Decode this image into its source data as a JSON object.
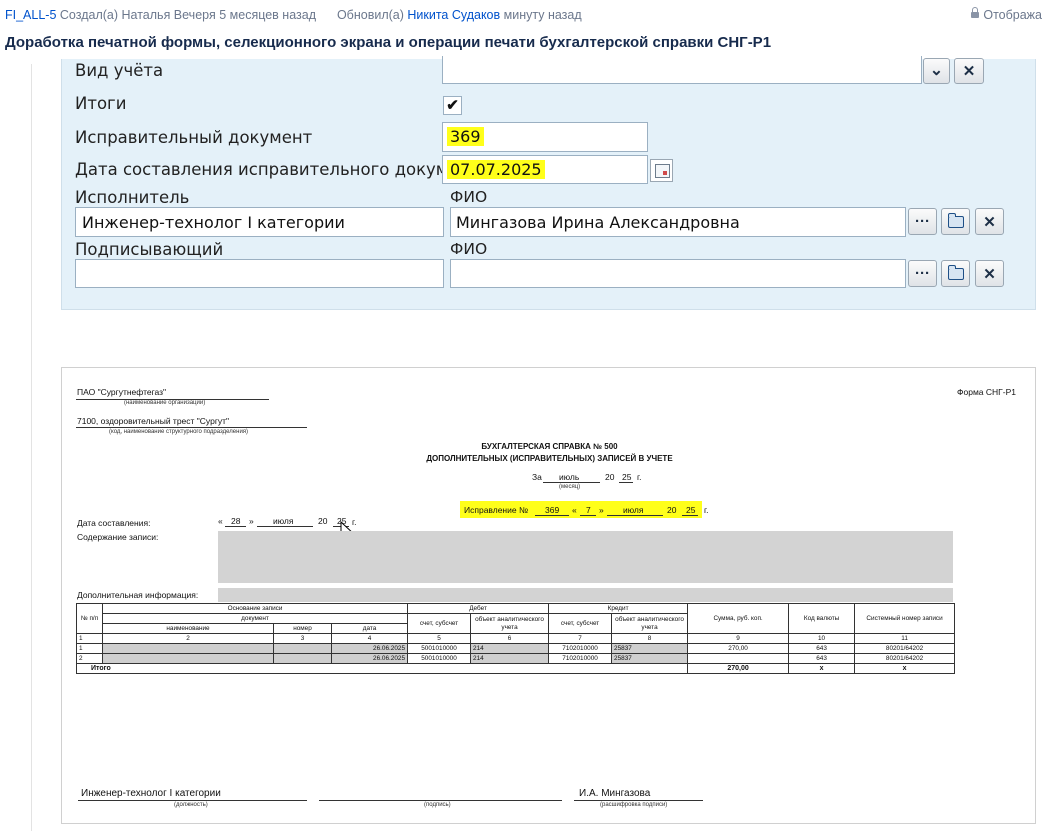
{
  "header": {
    "issue_key": "FI_ALL-5",
    "created_prefix": "Создал(а)",
    "creator": "Наталья Вечеря",
    "created_ago": "5 месяцев назад",
    "updated_prefix": "Обновил(а)",
    "updater": "Никита Судаков",
    "updated_ago": "минуту назад",
    "restrictions": "Отобража",
    "title": "Доработка печатной формы, селекционного экрана и операции печати бухгалтерской справки СНГ-Р1"
  },
  "form": {
    "vid_ucheta_label": "Вид учёта",
    "vid_ucheta_value": "",
    "itogi_label": "Итоги",
    "itogi_checked": "✔",
    "correction_doc_label": "Исправительный документ",
    "correction_doc_value": "369",
    "correction_date_label": "Дата составления исправительного документа",
    "correction_date_value": "07.07.2025",
    "executor_label": "Исполнитель",
    "executor_position": "Инженер-технолог I категории",
    "fio_label": "ФИО",
    "executor_fio": "Мингазова  Ирина Александровна",
    "signer_label": "Подписывающий",
    "signer_fio_label": "ФИО",
    "signer_position": "",
    "signer_fio": "",
    "dots": "···",
    "clear": "✕",
    "dropdown": "⌄"
  },
  "document": {
    "org_name": "ПАО \"Сургутнефтегаз\"",
    "org_caption": "(наименование организации)",
    "unit_name": "7100, оздоровительный трест \"Сургут\"",
    "unit_caption": "(код, наименование структурного подразделения)",
    "form_label": "Форма СНГ-Р1",
    "title_line1": "БУХГАЛТЕРСКАЯ СПРАВКА № 500",
    "title_line2": "ДОПОЛНИТЕЛЬНЫХ (ИСПРАВИТЕЛЬНЫХ) ЗАПИСЕЙ В УЧЕТЕ",
    "za": "За",
    "month": "июль",
    "twenty": "20",
    "year": "25",
    "g": "г.",
    "month_caption": "(месяц)",
    "correction_label": "Исправление №",
    "correction_no": "369",
    "q_open": "«",
    "correction_day": "7",
    "q_close": "»",
    "correction_month": "июля",
    "correction_year": "25",
    "date_label": "Дата составления:",
    "date_day": "28",
    "date_month": "июля",
    "date_year": "25",
    "content_label": "Содержание записи:",
    "extra_label": "Дополнительная информация:",
    "signer_position": "Инженер-технолог I категории",
    "signer_position_caption": "(должность)",
    "signature_caption": "(подпись)",
    "signer_name": "И.А. Мингазова",
    "signer_name_caption": "(расшифровка подписи)"
  },
  "table": {
    "h_no": "№ п/п",
    "h_basis": "Основание записи",
    "h_document": "документ",
    "h_name": "наименование",
    "h_number": "номер",
    "h_date": "дата",
    "h_debit": "Дебет",
    "h_credit": "Кредит",
    "h_account": "счет, субсчет",
    "h_object": "объект аналитического учета",
    "h_sum": "Сумма, руб. коп.",
    "h_currency": "Код валюты",
    "h_sysno": "Системный номер записи",
    "col_nums": [
      "1",
      "2",
      "3",
      "4",
      "5",
      "6",
      "7",
      "8",
      "9",
      "10",
      "11"
    ],
    "rows": [
      {
        "no": "1",
        "name": "",
        "number": "",
        "date": "26.06.2025",
        "debit_acc": "5001010000",
        "debit_obj": "214",
        "credit_acc": "7102010000",
        "credit_obj": "25837",
        "sum": "270,00",
        "currency": "643",
        "sysno": "80201/64202"
      },
      {
        "no": "2",
        "name": "",
        "number": "",
        "date": "26.06.2025",
        "debit_acc": "5001010000",
        "debit_obj": "214",
        "credit_acc": "7102010000",
        "credit_obj": "25837",
        "sum": "",
        "currency": "643",
        "sysno": "80201/64202"
      }
    ],
    "total_label": "Итого",
    "total_sum": "270,00",
    "total_currency": "x",
    "total_sysno": "x"
  },
  "colors": {
    "highlight": "#ffff1a",
    "panel": "#e4f1f9",
    "link": "#0052cc"
  }
}
